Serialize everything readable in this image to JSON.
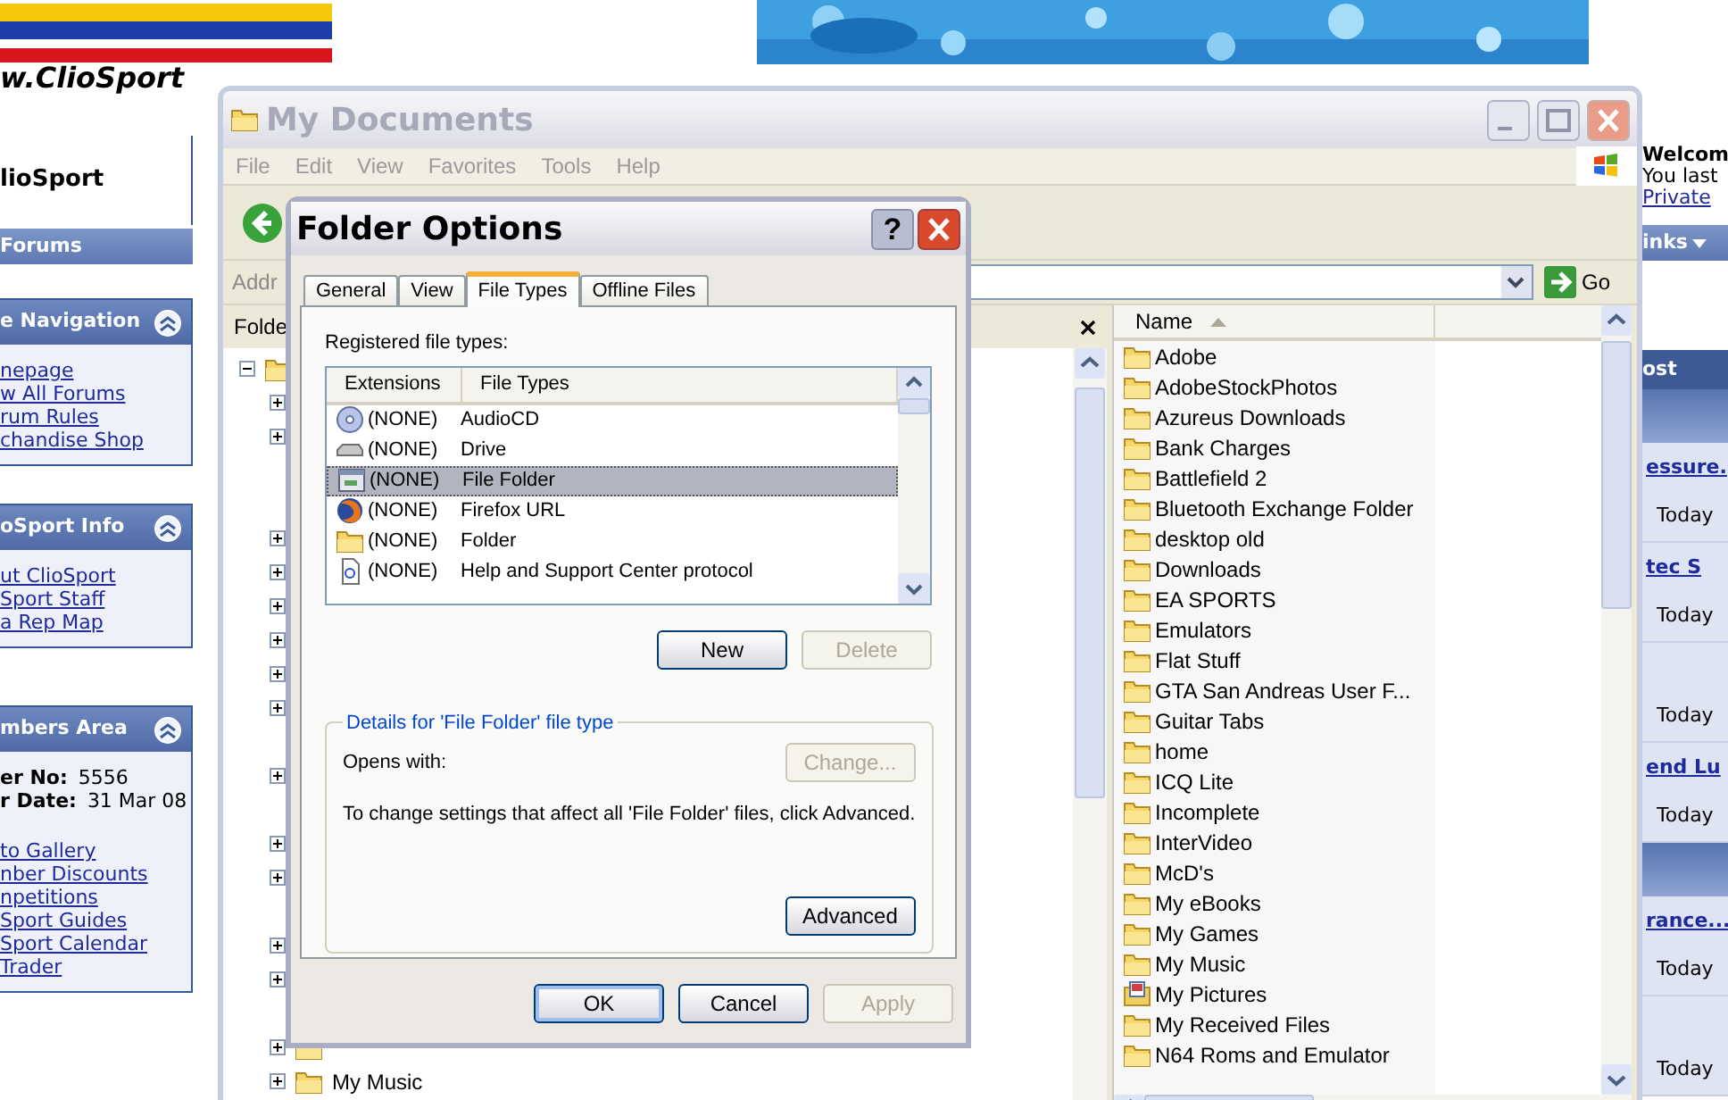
{
  "website": {
    "logo_text": "w.ClioSport",
    "site_title": "lioSport",
    "forums_bar": "Forums",
    "panels": [
      {
        "title": "e Navigation",
        "expanded": true,
        "links": [
          "nepage",
          "w All Forums",
          "rum Rules",
          "chandise Shop"
        ]
      },
      {
        "title": "oSport Info",
        "expanded": true,
        "links": [
          "ut ClioSport",
          "Sport Staff",
          "a Rep Map"
        ]
      },
      {
        "title": "mbers Area",
        "expanded": true,
        "fields": [
          {
            "label": "er No:",
            "value": "5556"
          },
          {
            "label": "r Date:",
            "value": "31 Mar 08"
          }
        ],
        "links": [
          "to Gallery",
          "nber Discounts",
          "npetitions",
          "Sport Guides",
          "Sport Calendar",
          "Trader"
        ]
      }
    ],
    "right": {
      "welcome": "Welcom",
      "last_visit": "You last",
      "private_link": "Private",
      "links_bar": "inks",
      "column_header": "ost",
      "rows": [
        {
          "kind": "band"
        },
        {
          "kind": "post",
          "title": "essure.",
          "time": "Today"
        },
        {
          "kind": "post",
          "title": "tec S",
          "time": "Today"
        },
        {
          "kind": "post",
          "time": "Today"
        },
        {
          "kind": "post",
          "title": "end Lu",
          "time": "Today"
        },
        {
          "kind": "band"
        },
        {
          "kind": "post",
          "title": "rance...",
          "time": "Today"
        },
        {
          "kind": "post",
          "time": "Today"
        }
      ]
    }
  },
  "explorer": {
    "title": "My Documents",
    "menu": [
      "File",
      "Edit",
      "View",
      "Favorites",
      "Tools",
      "Help"
    ],
    "address_label": "Addr",
    "go": "Go",
    "folders_label": "Folde",
    "tree": {
      "expanded": true,
      "children": [
        {
          "label": "My Music",
          "expanded": false
        }
      ]
    },
    "columns": [
      {
        "label": "Name",
        "sorted": true
      }
    ],
    "files": [
      {
        "name": "Adobe",
        "kind": "folder"
      },
      {
        "name": "AdobeStockPhotos",
        "kind": "folder"
      },
      {
        "name": "Azureus Downloads",
        "kind": "folder"
      },
      {
        "name": "Bank Charges",
        "kind": "folder"
      },
      {
        "name": "Battlefield 2",
        "kind": "folder"
      },
      {
        "name": "Bluetooth Exchange Folder",
        "kind": "folder"
      },
      {
        "name": "desktop old",
        "kind": "folder"
      },
      {
        "name": "Downloads",
        "kind": "folder"
      },
      {
        "name": "EA SPORTS",
        "kind": "folder"
      },
      {
        "name": "Emulators",
        "kind": "folder"
      },
      {
        "name": "Flat Stuff",
        "kind": "folder"
      },
      {
        "name": "GTA San Andreas User F...",
        "kind": "folder"
      },
      {
        "name": "Guitar Tabs",
        "kind": "folder"
      },
      {
        "name": "home",
        "kind": "folder"
      },
      {
        "name": "ICQ Lite",
        "kind": "folder"
      },
      {
        "name": "Incomplete",
        "kind": "folder"
      },
      {
        "name": "InterVideo",
        "kind": "folder"
      },
      {
        "name": "McD's",
        "kind": "folder"
      },
      {
        "name": "My eBooks",
        "kind": "folder"
      },
      {
        "name": "My Games",
        "kind": "folder"
      },
      {
        "name": "My Music",
        "kind": "folder"
      },
      {
        "name": "My Pictures",
        "kind": "pictures"
      },
      {
        "name": "My Received Files",
        "kind": "folder"
      },
      {
        "name": "N64 Roms and Emulator",
        "kind": "folder"
      }
    ]
  },
  "dialog": {
    "title": "Folder Options",
    "help_button": "?",
    "tabs": [
      {
        "label": "General",
        "selected": false
      },
      {
        "label": "View",
        "selected": false
      },
      {
        "label": "File Types",
        "selected": true
      },
      {
        "label": "Offline Files",
        "selected": false
      }
    ],
    "registered_label": "Registered file types:",
    "list_columns": [
      "Extensions",
      "File Types"
    ],
    "rows": [
      {
        "extension": "(NONE)",
        "type": "AudioCD",
        "kind": "cd",
        "selected": false
      },
      {
        "extension": "(NONE)",
        "type": "Drive",
        "kind": "drive",
        "selected": false
      },
      {
        "extension": "(NONE)",
        "type": "File Folder",
        "kind": "window",
        "selected": true
      },
      {
        "extension": "(NONE)",
        "type": "Firefox URL",
        "kind": "globe",
        "selected": false
      },
      {
        "extension": "(NONE)",
        "type": "Folder",
        "kind": "folder",
        "selected": false
      },
      {
        "extension": "(NONE)",
        "type": "Help and Support Center protocol",
        "kind": "document",
        "selected": false
      }
    ],
    "list_buttons": [
      {
        "label": "New",
        "disabled": false
      },
      {
        "label": "Delete",
        "disabled": true
      }
    ],
    "details_legend": "Details for 'File Folder' file type",
    "opens_with": "Opens with:",
    "change_button": {
      "label": "Change...",
      "disabled": true
    },
    "advice": "To change settings that affect all 'File Folder' files, click Advanced.",
    "advanced_button": {
      "label": "Advanced",
      "disabled": false
    },
    "footer_buttons": [
      {
        "label": "OK",
        "disabled": false,
        "default": true
      },
      {
        "label": "Cancel",
        "disabled": false,
        "default": false
      },
      {
        "label": "Apply",
        "disabled": true,
        "default": false
      }
    ]
  }
}
